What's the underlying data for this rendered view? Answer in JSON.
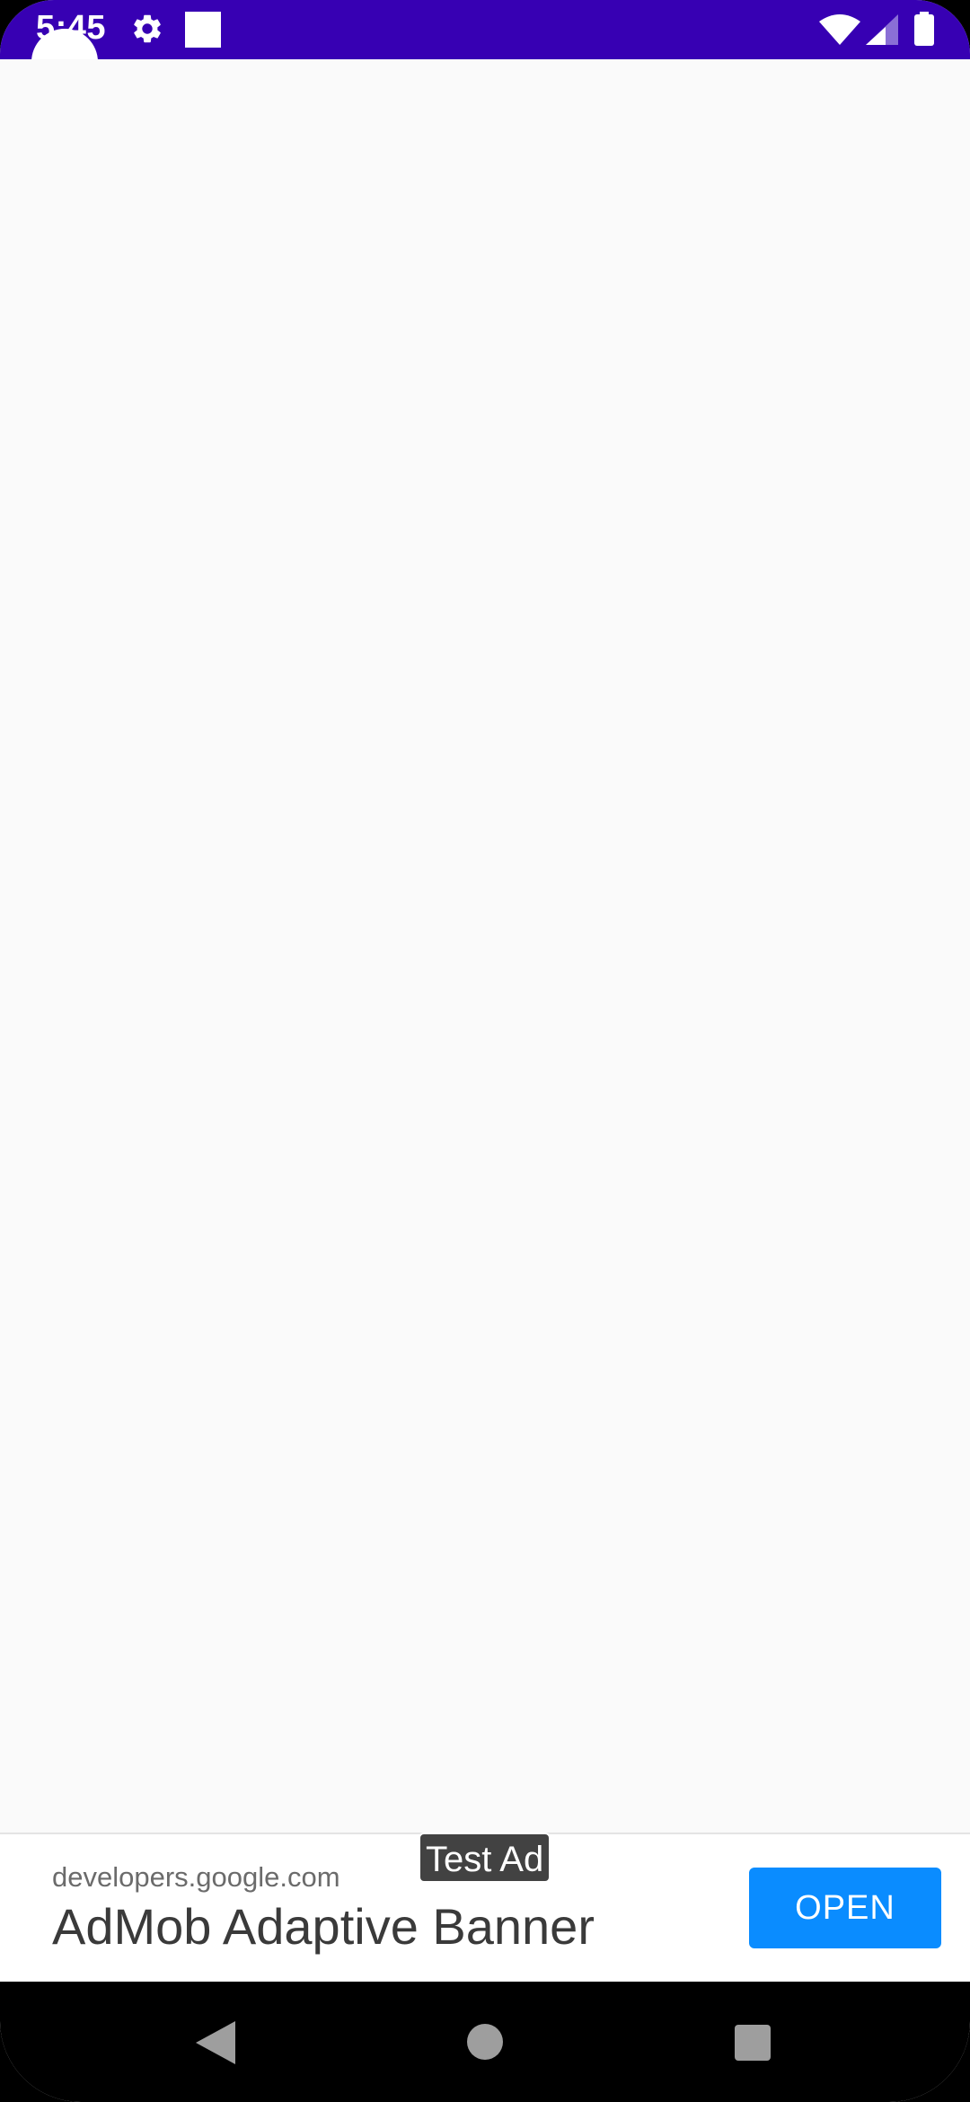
{
  "status_bar": {
    "time": "5:45",
    "background_color": "#3700b3",
    "icons": [
      "gear-icon",
      "notification-square-icon",
      "wifi-icon",
      "signal-icon",
      "battery-icon"
    ]
  },
  "content": {
    "background_color": "#fafafa"
  },
  "ad": {
    "badge": "Test Ad",
    "url": "developers.google.com",
    "headline": "AdMob Adaptive Banner",
    "button_label": "OPEN",
    "button_color": "#0a8cff"
  },
  "nav_bar": {
    "icons": [
      "back-icon",
      "home-icon",
      "recents-icon"
    ]
  }
}
